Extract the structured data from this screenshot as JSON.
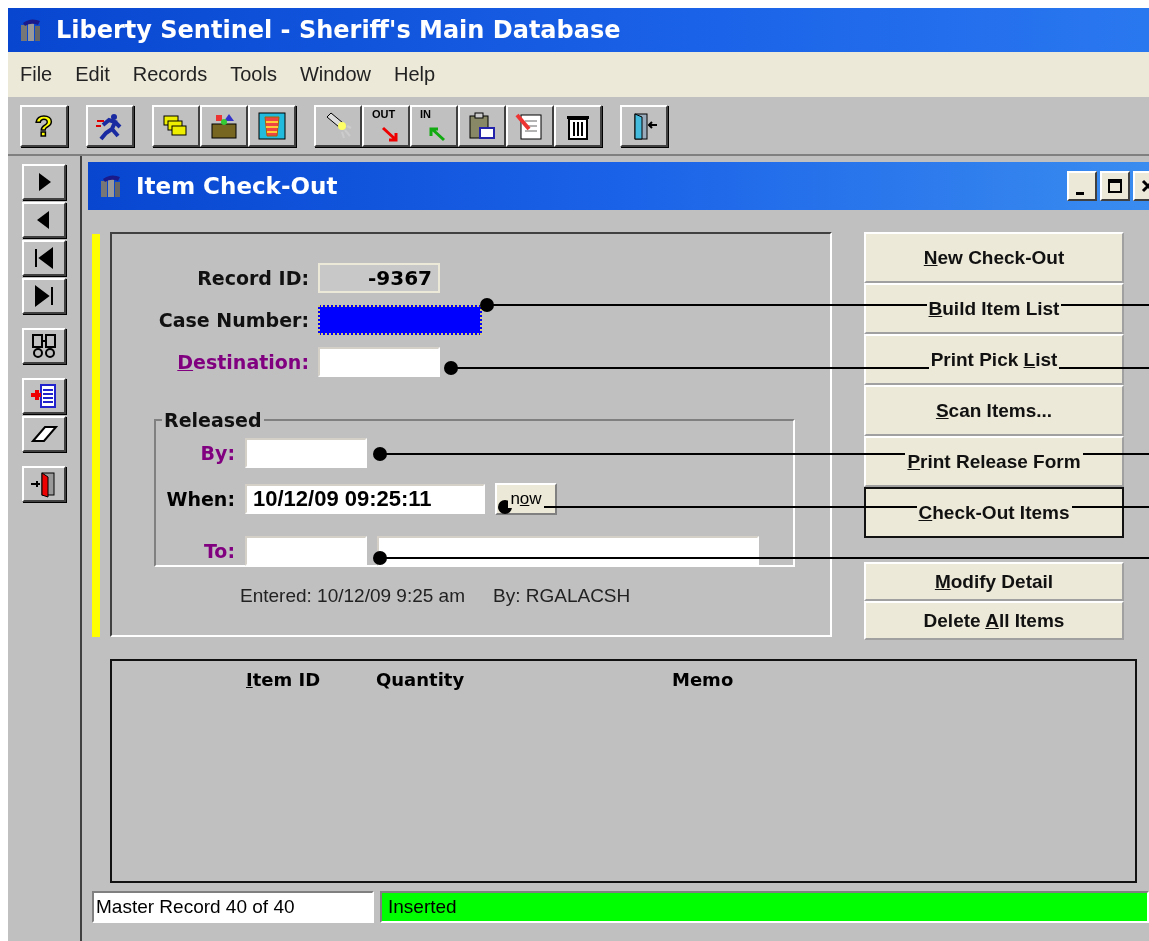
{
  "window": {
    "title": "Liberty Sentinel - Sheriff's Main Database"
  },
  "menu": [
    "File",
    "Edit",
    "Records",
    "Tools",
    "Window",
    "Help"
  ],
  "toolbar": [
    [
      {
        "kind": "help",
        "label": "?"
      }
    ],
    [
      {
        "kind": "runner"
      }
    ],
    [
      {
        "kind": "cards"
      },
      {
        "kind": "box"
      },
      {
        "kind": "basket"
      }
    ],
    [
      {
        "kind": "flashlight"
      },
      {
        "kind": "out",
        "label": "OUT"
      },
      {
        "kind": "in",
        "label": "IN"
      },
      {
        "kind": "clipboard"
      },
      {
        "kind": "notepad"
      },
      {
        "kind": "trash"
      }
    ],
    [
      {
        "kind": "door"
      }
    ]
  ],
  "nav": [
    [
      {
        "kind": "next"
      },
      {
        "kind": "prev"
      },
      {
        "kind": "first"
      },
      {
        "kind": "last"
      }
    ],
    [
      {
        "kind": "binoculars"
      }
    ],
    [
      {
        "kind": "insert"
      },
      {
        "kind": "eraser"
      }
    ],
    [
      {
        "kind": "exit"
      }
    ]
  ],
  "child": {
    "title": "Item Check-Out"
  },
  "form": {
    "record_id": {
      "label": {
        "before": "Record ID:"
      },
      "value": "-9367"
    },
    "case_number": {
      "label": {
        "before": "Case Number:"
      },
      "focused": true,
      "callout": true
    },
    "destination": {
      "label": {
        "key": "D",
        "after": "estination:"
      },
      "link": true,
      "callout": true
    },
    "released": {
      "title": "Released",
      "by": {
        "label": "By:",
        "callout": true
      },
      "when": {
        "label": "When:",
        "value": "10/12/09 09:25:11",
        "callout": true,
        "now": {
          "before": "n",
          "key": "o",
          "after": "w"
        }
      },
      "to": {
        "label": "To:",
        "callout": true
      }
    },
    "entered": "Entered: 10/12/09  9:25 am",
    "entered_by": "By: RGALACSH"
  },
  "actions": [
    [
      {
        "key": "N",
        "after": "ew Check-Out",
        "default": false
      },
      {
        "key": "B",
        "after": "uild Item List",
        "default": false
      },
      {
        "before": "Print Pick ",
        "key": "L",
        "after": "ist",
        "default": false
      },
      {
        "key": "S",
        "after": "can Items...",
        "default": false
      },
      {
        "key": "P",
        "after": "rint Release Form",
        "default": false
      },
      {
        "key": "C",
        "after": "heck-Out Items",
        "default": true
      }
    ],
    [
      {
        "key": "M",
        "after": "odify Detail",
        "default": false
      },
      {
        "before": "Delete ",
        "key": "A",
        "after": "ll Items",
        "default": false
      }
    ]
  ],
  "table": {
    "columns": [
      {
        "key": "I",
        "after": "tem ID"
      },
      {
        "before": "Quantity"
      },
      {
        "before": "Memo"
      }
    ]
  },
  "status_bar": {
    "record": "Master Record 40 of 40",
    "state": "Inserted"
  }
}
